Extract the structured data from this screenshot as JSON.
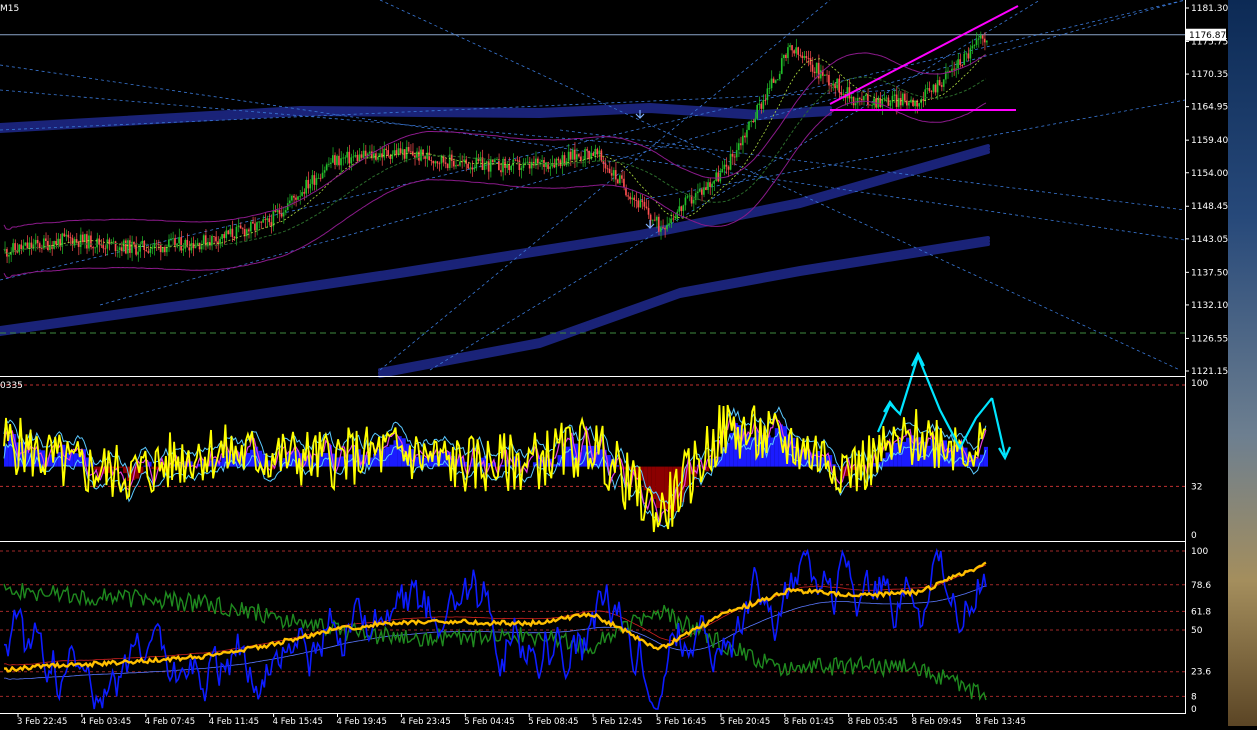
{
  "window": {
    "symbol_label": "M15"
  },
  "colors": {
    "background": "#000000",
    "axis": "#ffffff",
    "bull_candle": "#22c02a",
    "bear_candle": "#ff5050",
    "trend_magenta": "#ff00ff",
    "dash_blue": "#3a79d8",
    "channel_navy": "#1a2378",
    "stoch_yellow": "#ffff00",
    "hist_blue": "#1b1bff",
    "hist_red": "#8b0000",
    "cyan_arrow": "#00e5ff",
    "ind3_blue": "#0d1cff",
    "ind3_green": "#1f8a1f",
    "ind3_orange": "#ffc000"
  },
  "price_panel": {
    "current_price_label": "1176.87",
    "y_axis_labels": [
      "1181.30",
      "1175.75",
      "1170.35",
      "1164.95",
      "1159.40",
      "1154.00",
      "1148.45",
      "1143.05",
      "1137.50",
      "1132.10",
      "1126.55",
      "1121.15"
    ],
    "y_axis_values": [
      1181.3,
      1175.75,
      1170.35,
      1164.95,
      1159.4,
      1154.0,
      1148.45,
      1143.05,
      1137.5,
      1132.1,
      1126.55,
      1121.15
    ]
  },
  "osc_panel": {
    "indicator_label": "0335",
    "y_axis_labels": [
      "100",
      "32",
      "0"
    ],
    "y_axis_values": [
      100,
      32,
      0
    ]
  },
  "ind_panel": {
    "y_axis_labels": [
      "100",
      "78.6",
      "61.8",
      "50",
      "23.6",
      "8",
      "0"
    ],
    "y_axis_values": [
      100,
      78.6,
      61.8,
      50,
      23.6,
      8,
      0
    ]
  },
  "x_axis": {
    "labels": [
      "3 Feb 22:45",
      "4 Feb 03:45",
      "4 Feb 07:45",
      "4 Feb 11:45",
      "4 Feb 15:45",
      "4 Feb 19:45",
      "4 Feb 23:45",
      "5 Feb 04:45",
      "5 Feb 08:45",
      "5 Feb 12:45",
      "5 Feb 16:45",
      "5 Feb 20:45",
      "8 Feb 01:45",
      "8 Feb 05:45",
      "8 Feb 09:45",
      "8 Feb 13:45"
    ]
  },
  "chart_data": {
    "type": "line",
    "title": "",
    "x": [
      "3 Feb 22:45",
      "4 Feb 03:45",
      "4 Feb 07:45",
      "4 Feb 11:45",
      "4 Feb 15:45",
      "4 Feb 19:45",
      "4 Feb 23:45",
      "5 Feb 04:45",
      "5 Feb 08:45",
      "5 Feb 12:45",
      "5 Feb 16:45",
      "5 Feb 20:45",
      "8 Feb 01:45",
      "8 Feb 05:45",
      "8 Feb 09:45",
      "8 Feb 13:45"
    ],
    "price_ylim": [
      1121.15,
      1181.3
    ],
    "series": [
      {
        "values": [
          1141.0,
          1143.0,
          1141.5,
          1142.5,
          1145.5,
          1156.0,
          1157.5,
          1155.5,
          1155.0,
          1157.5,
          1145.0,
          1154.5,
          1174.5,
          1166.0,
          1166.0,
          1176.9
        ]
      }
    ],
    "oscillator": {
      "ylim": [
        0,
        100
      ],
      "level": 32,
      "values": [
        62,
        45,
        40,
        55,
        52,
        50,
        55,
        46,
        48,
        60,
        12,
        70,
        60,
        44,
        65,
        58
      ]
    },
    "indicator3": {
      "ylim": [
        0,
        100
      ],
      "levels": [
        78.6,
        61.8,
        50,
        23.6,
        8
      ],
      "values": [
        25,
        28,
        30,
        33,
        40,
        50,
        55,
        55,
        54,
        60,
        38,
        60,
        75,
        72,
        74,
        92
      ]
    }
  }
}
